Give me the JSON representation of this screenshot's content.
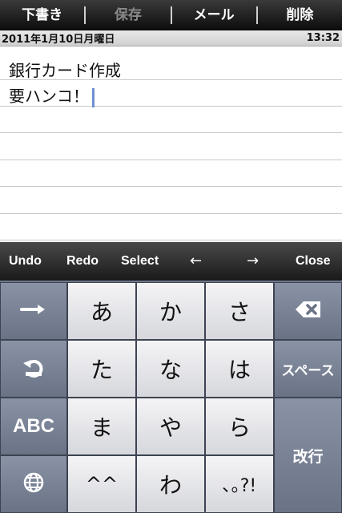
{
  "toolbar": {
    "draft": "下書き",
    "save": "保存",
    "mail": "メール",
    "delete": "削除"
  },
  "datebar": {
    "date": "2011年1月10日月曜日",
    "time": "13:32"
  },
  "note": {
    "lines": [
      "銀行カード作成",
      "要ハンコ！"
    ]
  },
  "editbar": {
    "undo": "Undo",
    "redo": "Redo",
    "select": "Select",
    "left": "←",
    "right": "→",
    "close": "Close"
  },
  "keyboard": {
    "rows": [
      [
        "あ",
        "か",
        "さ"
      ],
      [
        "た",
        "な",
        "は"
      ],
      [
        "ま",
        "や",
        "ら"
      ],
      [
        "^^",
        "わ",
        "､｡?!"
      ]
    ],
    "abc": "ABC",
    "space": "スペース",
    "return": "改行",
    "left_keys_icons": [
      "arrow-right-icon",
      "undo-icon",
      "",
      "globe-icon"
    ],
    "delete_icon": "backspace-icon"
  },
  "colors": {
    "cursor": "#6f8fd6",
    "keyboard_bg": "#6d7588"
  }
}
